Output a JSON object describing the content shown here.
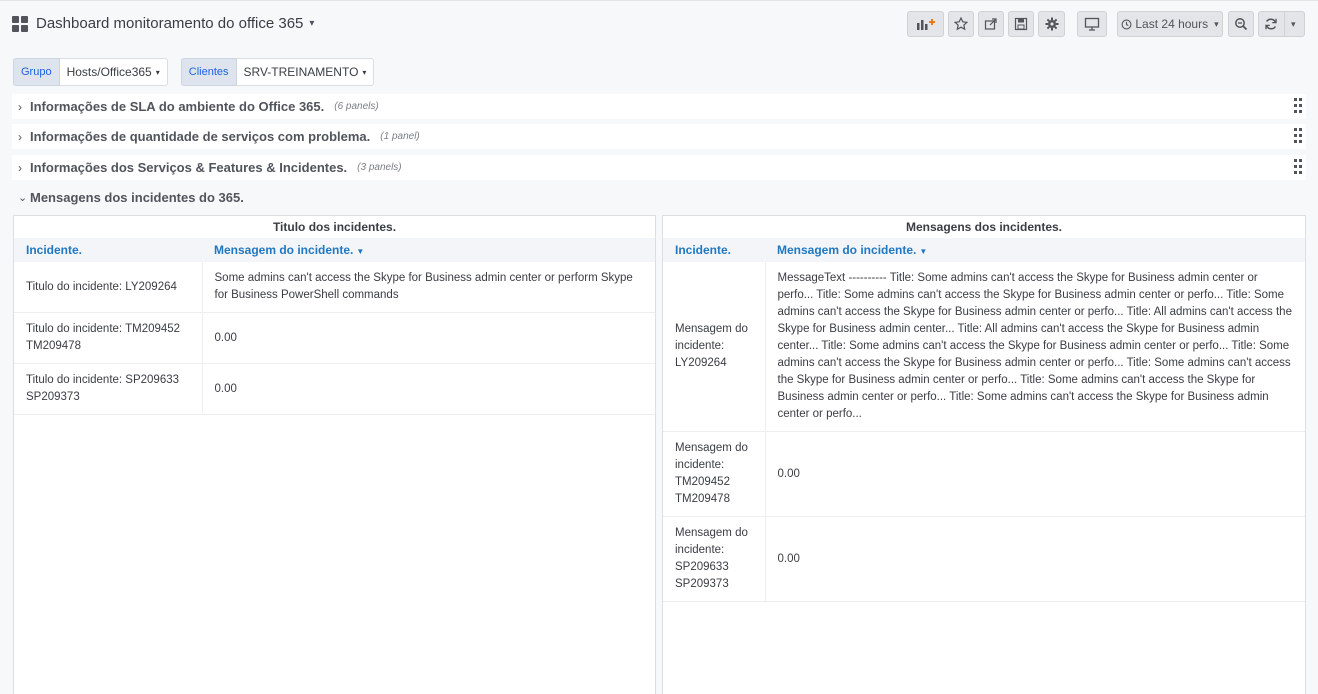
{
  "header": {
    "title": "Dashboard monitoramento do office 365",
    "time_range": "Last 24 hours"
  },
  "variables": [
    {
      "label": "Grupo",
      "value": "Hosts/Office365"
    },
    {
      "label": "Clientes",
      "value": "SRV-TREINAMENTO"
    }
  ],
  "rows": [
    {
      "title": "Informações de SLA do ambiente do Office 365.",
      "count": "(6 panels)"
    },
    {
      "title": "Informações de quantidade de serviços com problema.",
      "count": "(1 panel)"
    },
    {
      "title": "Informações dos Serviços & Features & Incidentes.",
      "count": "(3 panels)"
    },
    {
      "title": "Mensagens dos incidentes do 365."
    }
  ],
  "panels": [
    {
      "title": "Titulo dos incidentes.",
      "columns": [
        "Incidente.",
        "Mensagem do incidente."
      ],
      "rows": [
        [
          "Titulo do incidente: LY209264",
          "Some admins can't access the Skype for Business admin center or perform Skype for Business PowerShell commands"
        ],
        [
          "Titulo do incidente: TM209452 TM209478",
          "0.00"
        ],
        [
          "Titulo do incidente: SP209633 SP209373",
          "0.00"
        ]
      ]
    },
    {
      "title": "Mensagens dos incidentes.",
      "columns": [
        "Incidente.",
        "Mensagem do incidente."
      ],
      "rows": [
        [
          "Mensagem do incidente: LY209264",
          "MessageText ---------- Title: Some admins can't access the Skype for Business admin center or perfo... Title: Some admins can't access the Skype for Business admin center or perfo... Title: Some admins can't access the Skype for Business admin center or perfo... Title: All admins can't access the Skype for Business admin center... Title: All admins can't access the Skype for Business admin center... Title: Some admins can't access the Skype for Business admin center or perfo... Title: Some admins can't access the Skype for Business admin center or perfo... Title: Some admins can't access the Skype for Business admin center or perfo... Title: Some admins can't access the Skype for Business admin center or perfo... Title: Some admins can't access the Skype for Business admin center or perfo..."
        ],
        [
          "Mensagem do incidente: TM209452 TM209478",
          "0.00"
        ],
        [
          "Mensagem do incidente: SP209633 SP209373",
          "0.00"
        ]
      ]
    }
  ]
}
